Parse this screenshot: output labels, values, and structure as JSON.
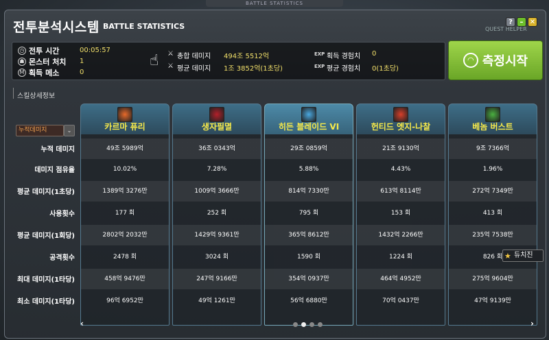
{
  "top_tab": "BATTLE STATISTICS",
  "window": {
    "title_ko": "전투분석시스템",
    "title_en": "BATTLE STATISTICS",
    "quest_hint": "QUEST HELPER"
  },
  "stats": {
    "time_label": "전투 시간",
    "time_value": "00:05:57",
    "kills_label": "몬스터 처치",
    "kills_value": "1",
    "meso_label": "획득 메소",
    "meso_value": "0",
    "total_dmg_label": "총합 데미지",
    "total_dmg_value": "494조 5512억",
    "avg_dmg_label": "평균 데미지",
    "avg_dmg_value": "1조 3852억(1초당)",
    "exp_tag": "EXP",
    "exp_label": "획득 경험치",
    "exp_value": "0",
    "avg_exp_label": "평균 경험치",
    "avg_exp_value": "0(1초당)"
  },
  "start_button": "측정시작",
  "side": {
    "section_label": "스킬상세정보",
    "dropdown_value": "누적데미지",
    "dropdown_arrow": "⌄"
  },
  "row_labels": [
    "누적 데미지",
    "데미지 점유율",
    "평균 데미지(1초당)",
    "사용횟수",
    "평균 데미지(1회당)",
    "공격횟수",
    "최대 데미지(1타당)",
    "최소 데미지(1타당)"
  ],
  "skills": [
    {
      "name": "카르마 퓨리",
      "icon_color": "#e86a2a",
      "values": [
        "49조 5989억",
        "10.02%",
        "1389억 3276만",
        "177 회",
        "2802억 2032만",
        "2478 회",
        "458억 9476만",
        "96억 6952만"
      ]
    },
    {
      "name": "생자필멸",
      "icon_color": "#b3202a",
      "values": [
        "36조 0343억",
        "7.28%",
        "1009억 3666만",
        "252 회",
        "1429억 9361만",
        "3024 회",
        "247억 9166만",
        "49억 1261만"
      ]
    },
    {
      "name": "히든 블레이드 VI",
      "icon_color": "#4aa8e0",
      "values": [
        "29조 0859억",
        "5.88%",
        "814억 7330만",
        "795 회",
        "365억 8612만",
        "1590 회",
        "354억 0937만",
        "56억 6880만"
      ]
    },
    {
      "name": "헌티드 엣지-나찰",
      "icon_color": "#d8402a",
      "values": [
        "21조 9130억",
        "4.43%",
        "613억 8114만",
        "153 회",
        "1432억 2266만",
        "1224 회",
        "464억 4952만",
        "70억 0437만"
      ]
    },
    {
      "name": "베놈 버스트",
      "icon_color": "#4ab040",
      "values": [
        "9조 7366억",
        "1.96%",
        "272억 7349만",
        "413 회",
        "235억 7538만",
        "826 회",
        "275억 9604만",
        "47억 9139만"
      ]
    }
  ],
  "nav": {
    "prev": "‹",
    "next": "›"
  },
  "hover_tag": "듀치진",
  "window_buttons": {
    "help": "?",
    "min": "–",
    "close": "✕"
  }
}
